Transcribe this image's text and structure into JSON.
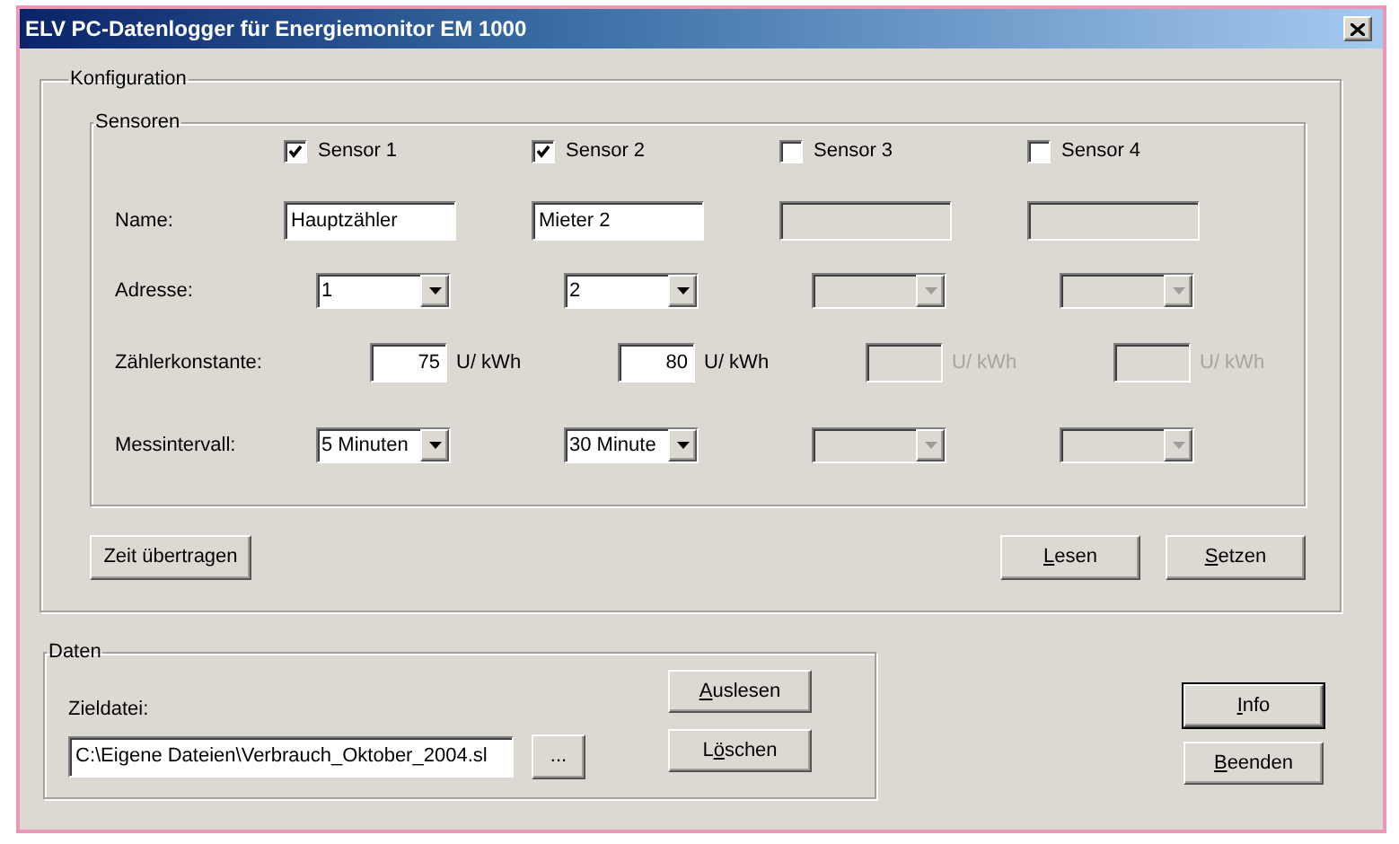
{
  "window": {
    "title": "ELV PC-Datenlogger für Energiemonitor EM 1000"
  },
  "configuration": {
    "title": "Konfiguration",
    "sensors_group": {
      "title": "Sensoren",
      "row_labels": [
        "Name:",
        "Adresse:",
        "Zählerkonstante:",
        "Messintervall:"
      ],
      "sensors": [
        {
          "label": "Sensor 1",
          "checked": true,
          "name": "Hauptzähler",
          "address": "1",
          "constant": "75",
          "unit": "U/ kWh",
          "interval": "5 Minuten"
        },
        {
          "label": "Sensor 2",
          "checked": true,
          "name": "Mieter 2",
          "address": "2",
          "constant": "80",
          "unit": "U/ kWh",
          "interval": "30 Minute"
        },
        {
          "label": "Sensor 3",
          "checked": false,
          "unit": "U/ kWh"
        },
        {
          "label": "Sensor 4",
          "checked": false,
          "unit": "U/ kWh"
        }
      ]
    },
    "buttons": [
      {
        "label": "Zeit übertragen"
      },
      {
        "accel": "L",
        "after": "esen"
      },
      {
        "accel": "S",
        "after": "etzen"
      }
    ]
  },
  "data": {
    "title": "Daten",
    "target_label": "Zieldatei:",
    "target_path": "C:\\Eigene Dateien\\Verbrauch_Oktober_2004.sl",
    "browse_button": "...",
    "buttons": [
      {
        "accel": "A",
        "after": "uslesen"
      },
      {
        "before": "L",
        "accel": "ö",
        "after": "schen"
      }
    ]
  },
  "buttons": [
    {
      "accel": "I",
      "after": "nfo",
      "default": true
    },
    {
      "accel": "B",
      "after": "eenden",
      "default": false
    }
  ]
}
